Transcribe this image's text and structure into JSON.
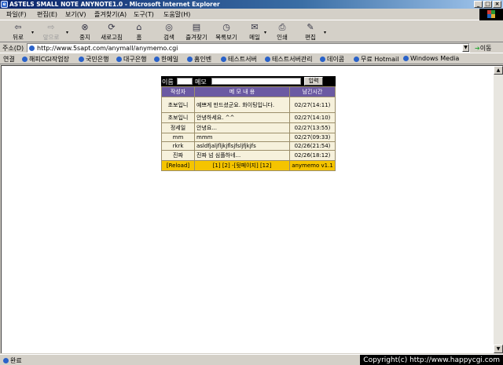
{
  "window": {
    "title": "ASTELS SMALL NOTE ANYNOTE1.0 - Microsoft Internet Explorer",
    "icon": "ie-icon",
    "controls": [
      "_",
      "□",
      "×"
    ]
  },
  "menu": [
    "파일(F)",
    "편집(E)",
    "보기(V)",
    "즐겨찾기(A)",
    "도구(T)",
    "도움말(H)"
  ],
  "toolbar": {
    "back": "뒤로",
    "forward": "앞으로",
    "stop": "중지",
    "refresh": "새로고침",
    "home": "홈",
    "search": "검색",
    "favorites": "즐겨찾기",
    "history": "목록보기",
    "mail": "메일",
    "print": "인쇄",
    "edit": "편집"
  },
  "address": {
    "label": "주소(D)",
    "url": "http://www.5sapt.com/anymall/anymemo.cgi",
    "go": "이동"
  },
  "links": {
    "label": "연결",
    "items": [
      "해피CGI작업장",
      "국민은행",
      "대구은행",
      "한메일",
      "홈인벤",
      "테스트서버",
      "테스트서버관리",
      "데이콤",
      "무료 Hotmail",
      "Windows Media"
    ]
  },
  "memo": {
    "name_label": "이름",
    "memo_label": "메모",
    "submit_label": "입력",
    "columns": [
      "작성자",
      "메 모 내 용",
      "남긴시간"
    ],
    "rows": [
      {
        "author": "초보입니",
        "message": "예쁘게 만드셨군요. 화이팅입니다.",
        "time": "02/27(14:11)"
      },
      {
        "author": "초보입니",
        "message": "안녕하세요. ^^",
        "time": "02/27(14:10)"
      },
      {
        "author": "정세일",
        "message": "안녕요...",
        "time": "02/27(13:55)"
      },
      {
        "author": "mm",
        "message": "mmm",
        "time": "02/27(09:33)"
      },
      {
        "author": "rkrk",
        "message": "asldfjaljfljkjflsjfsljfjkjfs",
        "time": "02/26(21:54)"
      },
      {
        "author": "진짜",
        "message": "진짜 넘 심플하네...",
        "time": "02/26(18:12)"
      }
    ],
    "footer": {
      "reload": "[Reload]",
      "pages": "[1] [2] -[뒷페이지] [12]",
      "version": "anymemo v1.1"
    }
  },
  "status": {
    "text": "완료",
    "copyright": "Copyright(c) http://www.happycgi.com"
  }
}
